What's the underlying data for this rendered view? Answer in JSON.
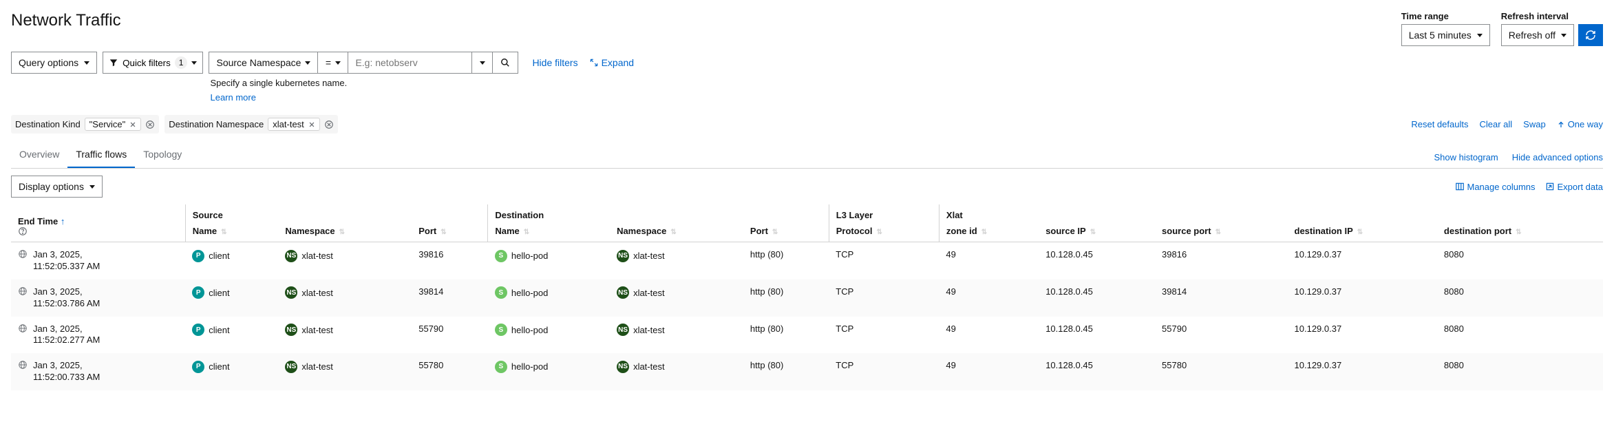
{
  "page": {
    "title": "Network Traffic"
  },
  "topControls": {
    "timeRange": {
      "label": "Time range",
      "value": "Last 5 minutes"
    },
    "refresh": {
      "label": "Refresh interval",
      "value": "Refresh off"
    }
  },
  "toolbar": {
    "queryOptions": "Query options",
    "quickFilters": {
      "label": "Quick filters",
      "count": "1"
    },
    "filter": {
      "field": "Source Namespace",
      "op": "=",
      "placeholder": "E.g: netobserv"
    },
    "hint": "Specify a single kubernetes name.",
    "learnMore": "Learn more",
    "hideFilters": "Hide filters",
    "expand": "Expand"
  },
  "chips": [
    {
      "label": "Destination Kind",
      "value": "\"Service\""
    },
    {
      "label": "Destination Namespace",
      "value": "xlat-test"
    }
  ],
  "chipActions": {
    "reset": "Reset defaults",
    "clearAll": "Clear all",
    "swap": "Swap",
    "oneWay": "One way"
  },
  "tabs": {
    "overview": "Overview",
    "flows": "Traffic flows",
    "topology": "Topology",
    "showHistogram": "Show histogram",
    "hideAdvanced": "Hide advanced options"
  },
  "tableToolbar": {
    "displayOptions": "Display options",
    "manageColumns": "Manage columns",
    "exportData": "Export data"
  },
  "columns": {
    "endTime": "End Time",
    "sourceGroup": "Source",
    "srcName": "Name",
    "srcNamespace": "Namespace",
    "srcPort": "Port",
    "destGroup": "Destination",
    "dstName": "Name",
    "dstNamespace": "Namespace",
    "dstPort": "Port",
    "l3Group": "L3 Layer",
    "protocol": "Protocol",
    "xlatGroup": "Xlat",
    "zoneId": "zone id",
    "sourceIp": "source IP",
    "sourcePort": "source port",
    "destinationIp": "destination IP",
    "destinationPort": "destination port"
  },
  "rows": [
    {
      "time1": "Jan 3, 2025,",
      "time2": "11:52:05.337 AM",
      "srcName": "client",
      "srcNs": "xlat-test",
      "srcPort": "39816",
      "dstName": "hello-pod",
      "dstNs": "xlat-test",
      "dstPort": "http (80)",
      "proto": "TCP",
      "zone": "49",
      "xSrcIp": "10.128.0.45",
      "xSrcPort": "39816",
      "xDstIp": "10.129.0.37",
      "xDstPort": "8080"
    },
    {
      "time1": "Jan 3, 2025,",
      "time2": "11:52:03.786 AM",
      "srcName": "client",
      "srcNs": "xlat-test",
      "srcPort": "39814",
      "dstName": "hello-pod",
      "dstNs": "xlat-test",
      "dstPort": "http (80)",
      "proto": "TCP",
      "zone": "49",
      "xSrcIp": "10.128.0.45",
      "xSrcPort": "39814",
      "xDstIp": "10.129.0.37",
      "xDstPort": "8080"
    },
    {
      "time1": "Jan 3, 2025,",
      "time2": "11:52:02.277 AM",
      "srcName": "client",
      "srcNs": "xlat-test",
      "srcPort": "55790",
      "dstName": "hello-pod",
      "dstNs": "xlat-test",
      "dstPort": "http (80)",
      "proto": "TCP",
      "zone": "49",
      "xSrcIp": "10.128.0.45",
      "xSrcPort": "55790",
      "xDstIp": "10.129.0.37",
      "xDstPort": "8080"
    },
    {
      "time1": "Jan 3, 2025,",
      "time2": "11:52:00.733 AM",
      "srcName": "client",
      "srcNs": "xlat-test",
      "srcPort": "55780",
      "dstName": "hello-pod",
      "dstNs": "xlat-test",
      "dstPort": "http (80)",
      "proto": "TCP",
      "zone": "49",
      "xSrcIp": "10.128.0.45",
      "xSrcPort": "55780",
      "xDstIp": "10.129.0.37",
      "xDstPort": "8080"
    }
  ]
}
